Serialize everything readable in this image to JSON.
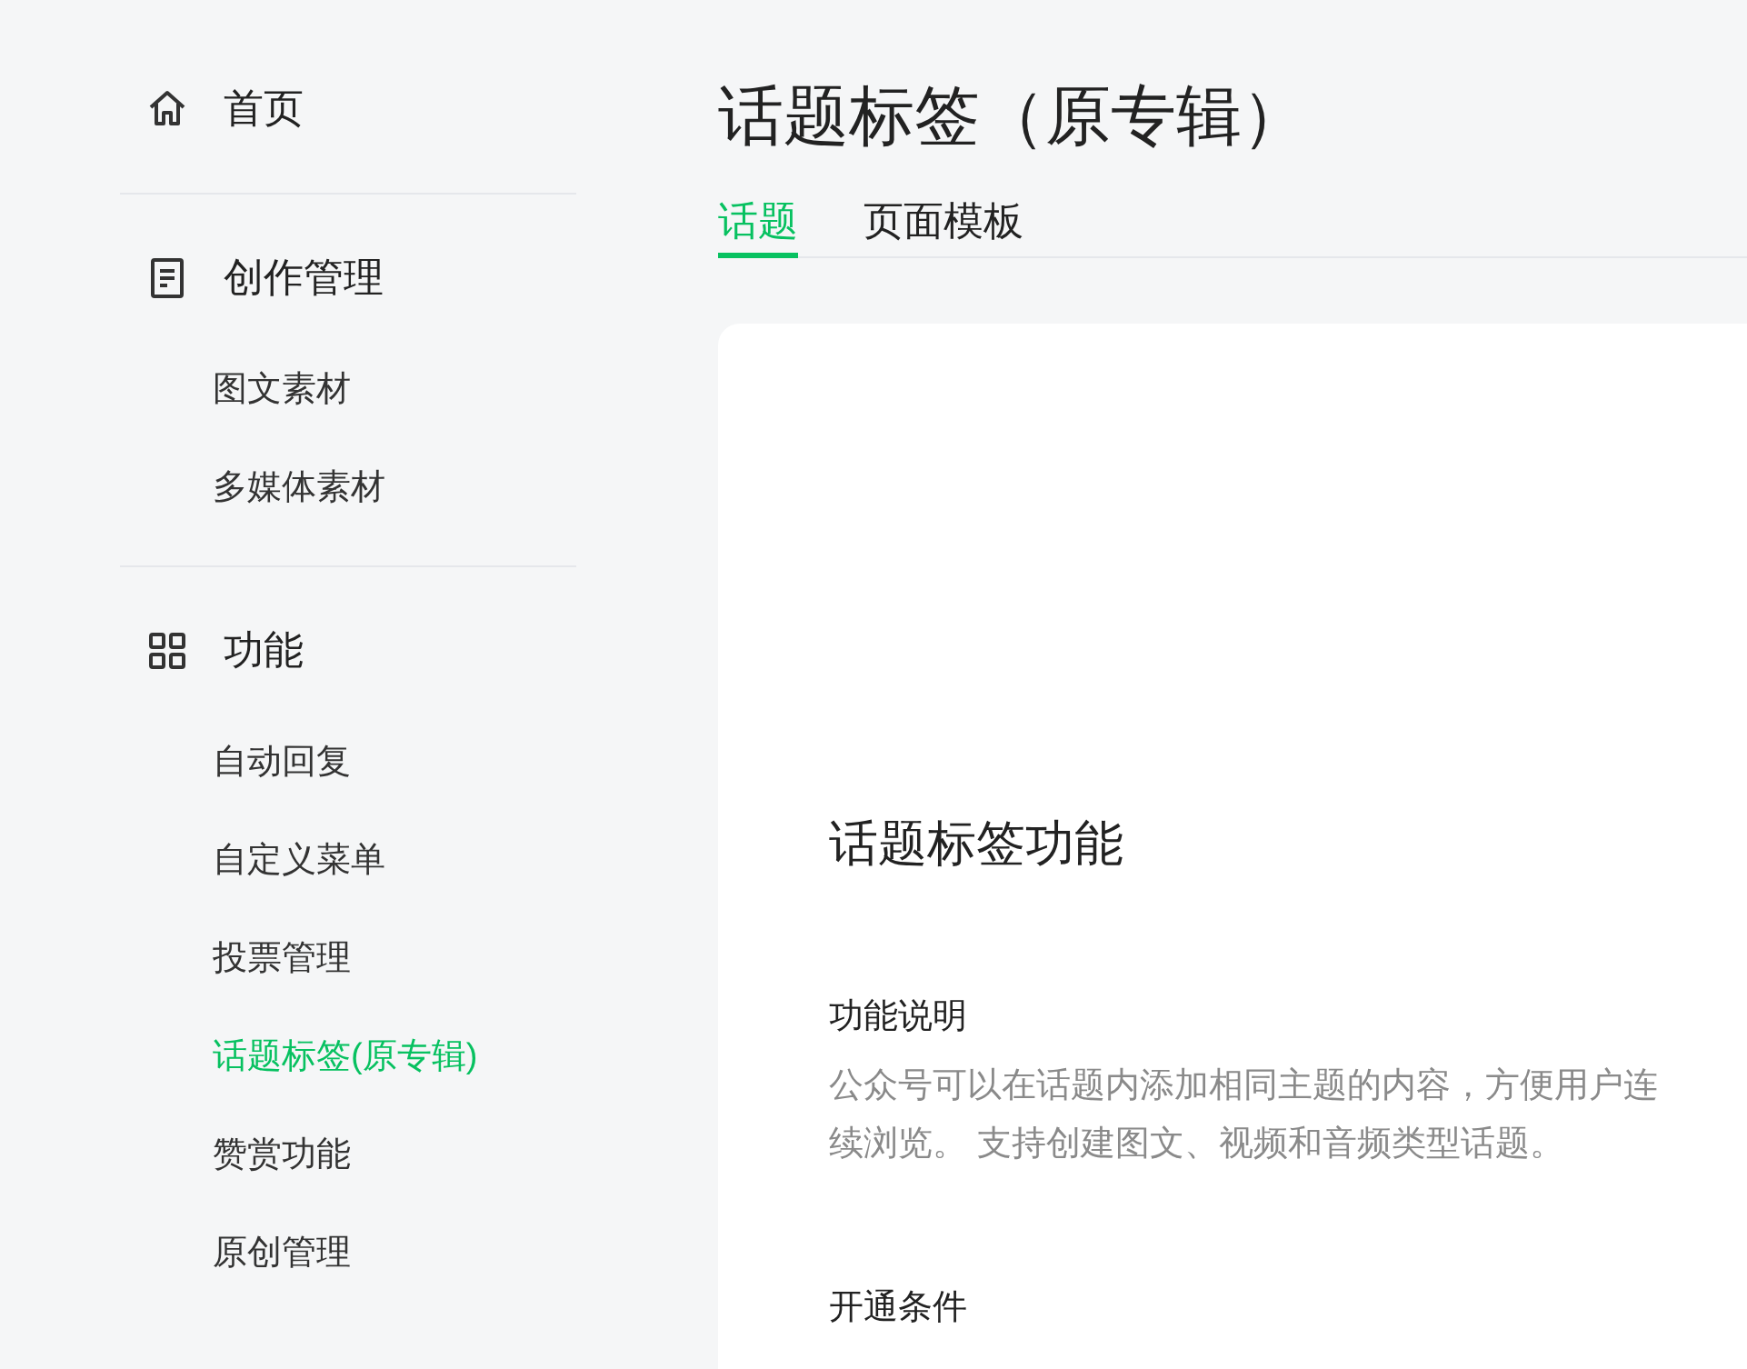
{
  "sidebar": {
    "sections": [
      {
        "label": "首页"
      },
      {
        "label": "创作管理",
        "items": [
          {
            "label": "图文素材",
            "selected": false
          },
          {
            "label": "多媒体素材",
            "selected": false
          }
        ]
      },
      {
        "label": "功能",
        "items": [
          {
            "label": "自动回复",
            "selected": false
          },
          {
            "label": "自定义菜单",
            "selected": false
          },
          {
            "label": "投票管理",
            "selected": false
          },
          {
            "label": "话题标签(原专辑)",
            "selected": true
          },
          {
            "label": "赞赏功能",
            "selected": false
          },
          {
            "label": "原创管理",
            "selected": false
          }
        ]
      }
    ]
  },
  "page_title": "话题标签（原专辑）",
  "tabs": [
    {
      "label": "话题",
      "selected": true
    },
    {
      "label": "页面模板",
      "selected": false
    }
  ],
  "card": {
    "heading": "话题标签功能",
    "sections": [
      {
        "title": "功能说明",
        "text": "公众号可以在话题内添加相同主题的内容，方便用户连续浏览。 支持创建图文、视频和音频类型话题。"
      },
      {
        "title": "开通条件"
      }
    ]
  }
}
